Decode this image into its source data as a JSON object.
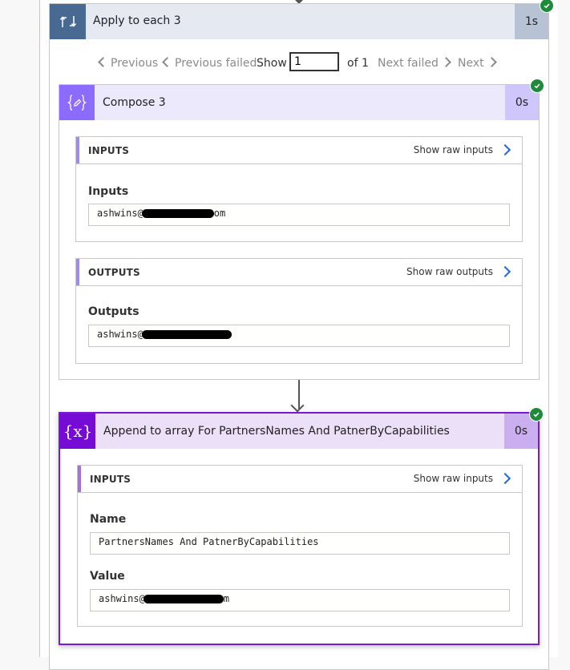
{
  "colors": {
    "loop_icon_bg": "#486991",
    "loop_header_bg": "#e5e9f1",
    "loop_duration_bg": "#b7c3d4",
    "compose_icon_bg": "#8c6cff",
    "compose_header_bg": "#ece9fd",
    "compose_duration_bg": "#cfc6fb",
    "append_icon_bg": "#770bd6",
    "append_header_bg": "#ecdff8",
    "append_duration_bg": "#cbaef0",
    "append_border": "#7719d5",
    "success": "#1f8a3a",
    "link_chevron": "#2266e3"
  },
  "loop": {
    "icon": "loop-arrows-icon",
    "title": "Apply to each 3",
    "duration": "1s",
    "status": "succeeded",
    "pager": {
      "previous_label": "Previous",
      "previous_failed_label": "Previous failed",
      "show_label": "Show",
      "current_value": "1",
      "of_label": "of 1",
      "next_failed_label": "Next failed",
      "next_label": "Next"
    }
  },
  "compose": {
    "icon": "compose-braces-pencil-icon",
    "title": "Compose 3",
    "duration": "0s",
    "status": "succeeded",
    "inputs_section": {
      "title": "INPUTS",
      "raw_link": "Show raw inputs",
      "fields": [
        {
          "label": "Inputs",
          "value_prefix": "ashwins@",
          "value_suffix": "om",
          "redacted": true
        }
      ]
    },
    "outputs_section": {
      "title": "OUTPUTS",
      "raw_link": "Show raw outputs",
      "fields": [
        {
          "label": "Outputs",
          "value_prefix": "ashwins@",
          "value_suffix": "",
          "redacted": true
        }
      ]
    }
  },
  "append": {
    "icon": "variable-x-icon",
    "icon_text": "{x}",
    "title": "Append to array For PartnersNames And PatnerByCapabilities",
    "duration": "0s",
    "status": "succeeded",
    "inputs_section": {
      "title": "INPUTS",
      "raw_link": "Show raw inputs",
      "fields": [
        {
          "label": "Name",
          "value": "PartnersNames And PatnerByCapabilities"
        },
        {
          "label": "Value",
          "value_prefix": "ashwins@",
          "value_suffix": "m",
          "redacted": true
        }
      ]
    }
  }
}
